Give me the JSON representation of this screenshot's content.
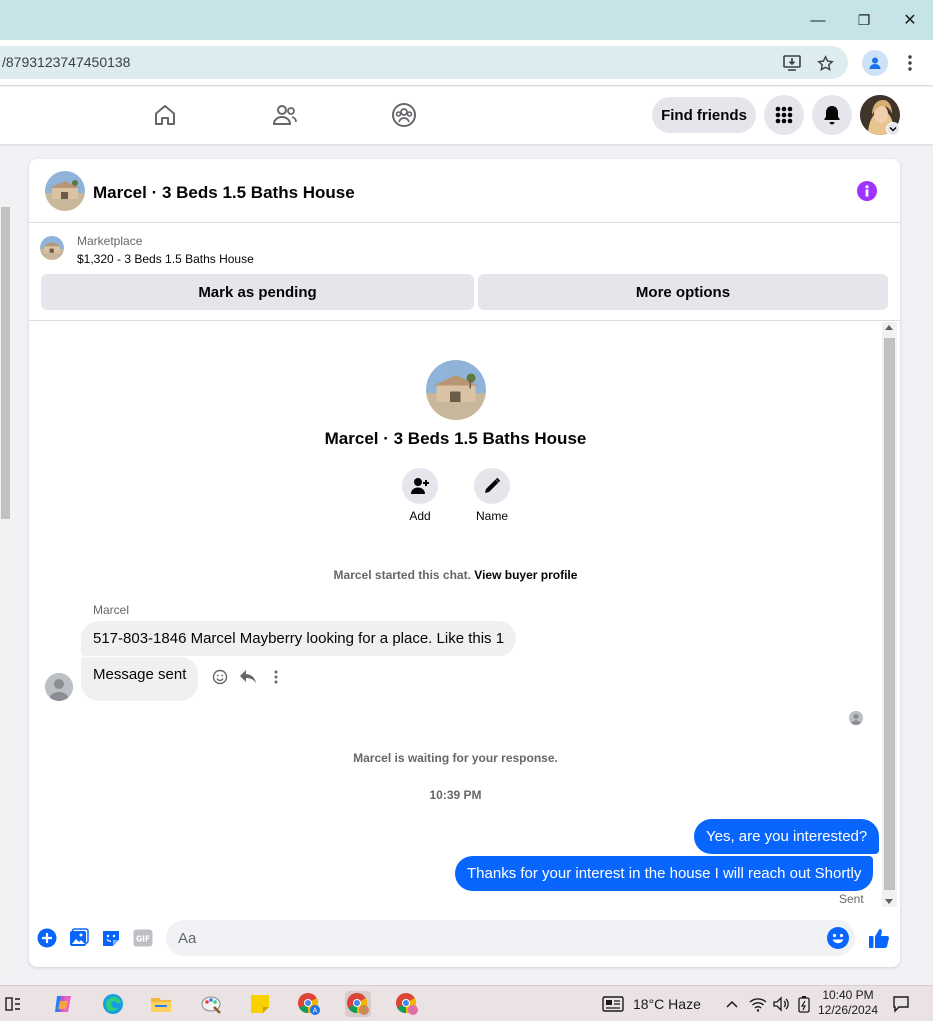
{
  "browser": {
    "url": "/8793123747450138",
    "window_controls": {
      "minimize": "—",
      "restore": "❐",
      "close": "✕"
    }
  },
  "fb_nav": {
    "find_friends_label": "Find friends"
  },
  "chat": {
    "header_title": "Marcel · 3 Beds 1.5 Baths House",
    "marketplace_label": "Marketplace",
    "listing": "$1,320 - 3 Beds 1.5 Baths House",
    "mark_pending_label": "Mark as pending",
    "more_options_label": "More options",
    "profile_title": "Marcel · 3 Beds 1.5 Baths House",
    "actions": [
      {
        "label": "Add",
        "icon": "add-person-icon"
      },
      {
        "label": "Name",
        "icon": "pencil-icon"
      }
    ],
    "started_text": "Marcel started this chat.",
    "view_profile_link": "View buyer profile",
    "sender_name": "Marcel",
    "incoming": [
      "517-803-1846 Marcel Mayberry looking for a place. Like this 1",
      "Message sent"
    ],
    "waiting_text": "Marcel is waiting for your response.",
    "timestamp": "10:39 PM",
    "outgoing": [
      "Yes, are you interested?",
      "Thanks for your interest in the house I will reach out Shortly"
    ],
    "sent_label": "Sent",
    "composer_placeholder": "Aa",
    "accent_color": "#0866ff"
  },
  "taskbar": {
    "weather": "18°C  Haze",
    "time": "10:40 PM",
    "date": "12/26/2024"
  }
}
